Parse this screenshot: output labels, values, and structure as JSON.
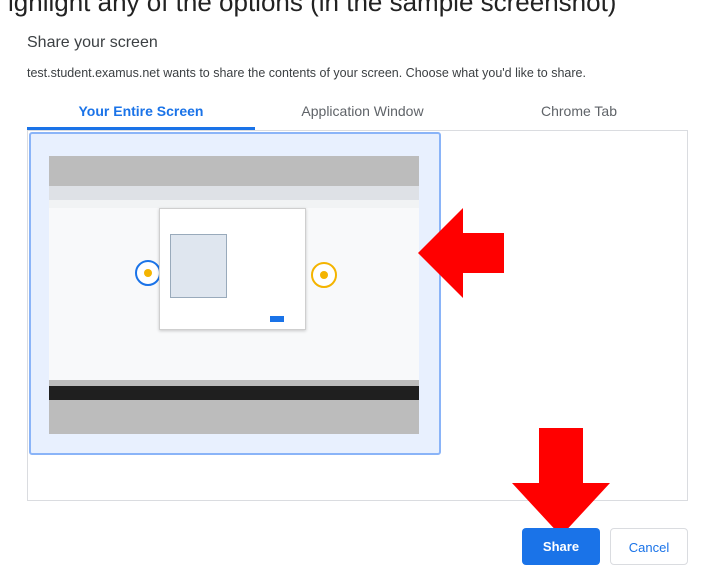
{
  "top_caption": "ighlight any of the options (in the sample screenshot)",
  "dialog": {
    "title": "Share your screen",
    "subtitle": "test.student.examus.net wants to share the contents of your screen. Choose what you'd like to share."
  },
  "tabs": [
    {
      "label": "Your Entire Screen",
      "active": true
    },
    {
      "label": "Application Window",
      "active": false
    },
    {
      "label": "Chrome Tab",
      "active": false
    }
  ],
  "buttons": {
    "share": "Share",
    "cancel": "Cancel"
  },
  "colors": {
    "accent": "#1a73e8",
    "annotation_arrow": "#ff0000"
  },
  "icons": {
    "left_arrow": "red-arrow-left-icon",
    "down_arrow": "red-arrow-down-icon"
  }
}
